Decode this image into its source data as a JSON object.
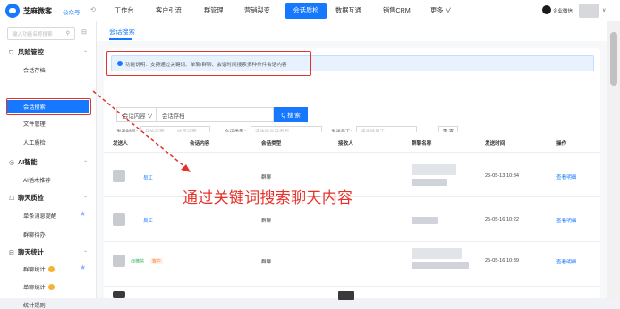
{
  "topbar": {
    "brand": "芝麻微客",
    "account_type": "公众号",
    "nav": [
      "工作台",
      "客户引流",
      "群管理",
      "营销裂变",
      "会话质检",
      "数据互通",
      "销售CRM",
      "更多 ∨"
    ],
    "active_nav": "会话质检",
    "user_name": "企业微信",
    "dropdown_glyph": "∨"
  },
  "sidebar": {
    "search_placeholder": "输入功能名称搜索",
    "groups": [
      {
        "icon": "shield-icon",
        "icon_glyph": "⛉",
        "label": "风险管控",
        "items": [
          "会话存档",
          "会话搜索",
          "文件管理",
          "人工质检"
        ]
      },
      {
        "icon": "ai-icon",
        "icon_glyph": "◎",
        "label": "AI智能",
        "items": [
          "AI话术推荐"
        ]
      },
      {
        "icon": "chat-icon",
        "icon_glyph": "☖",
        "label": "聊天质检",
        "items": [
          "单条消息提醒",
          "群聊待办"
        ]
      },
      {
        "icon": "stats-icon",
        "icon_glyph": "⊟",
        "label": "聊天统计",
        "items": [
          "群聊统计",
          "单聊统计",
          "统计规则"
        ]
      }
    ],
    "active_item": "会话搜索"
  },
  "main": {
    "tab": "会话搜索",
    "notice": "功能说明：支持通过关键词、单聊/群聊、会话时间搜索多种条件会话内容",
    "search_select": "会话内容 ∨",
    "search_placeholder": "会话存档",
    "search_button": "Q 搜 索",
    "filters": {
      "time_label": "发送时间：",
      "start_placeholder": "开始日期",
      "to": "→",
      "end_placeholder": "结束日期",
      "type_label": "会话类型：",
      "type_placeholder": "请选择会话类型",
      "staff_label": "发送员工：",
      "staff_placeholder": "请选择员工",
      "reset": "重 置"
    },
    "table": {
      "headers": [
        "发送人",
        "会话内容",
        "会话类型",
        "接收人",
        "群聊名称",
        "发送时间",
        "操作"
      ],
      "rows": [
        {
          "sender": "员工",
          "type": "群聊",
          "time": "25-05-13 10:34",
          "op": "查看明细"
        },
        {
          "sender": "员工",
          "type": "群聊",
          "time": "25-05-16 10:22",
          "op": "查看明细"
        },
        {
          "sender": "@微信",
          "tag": "客户",
          "type": "群聊",
          "time": "25-05-16 10:39",
          "op": "查看明细"
        }
      ]
    }
  },
  "annotation": "通过关键词搜索聊天内容",
  "colors": {
    "primary": "#1677ff",
    "annotation_red": "#e3322b"
  }
}
